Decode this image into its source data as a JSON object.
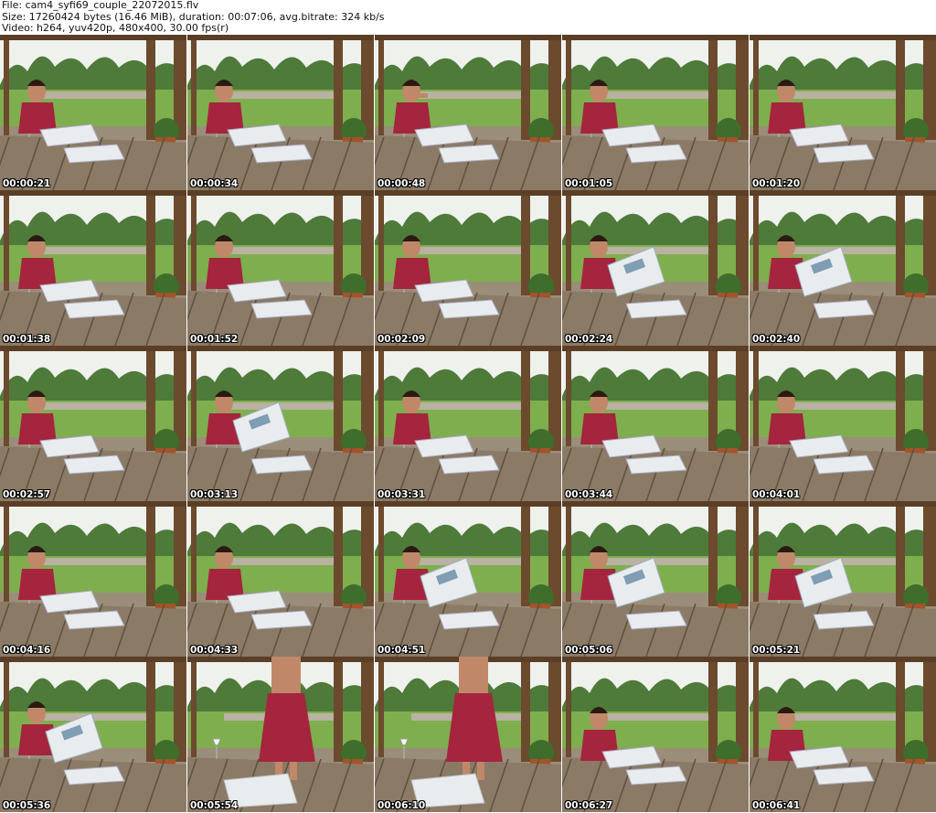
{
  "header": {
    "file_line": "File: cam4_syfi69_couple_22072015.flv",
    "size_line": "Size: 17260424 bytes (16.46 MiB), duration: 00:07:06, avg.bitrate: 324 kb/s",
    "video_line": "Video: h264, yuv420p, 480x400, 30.00 fps(r)"
  },
  "colors": {
    "sky": "#eef1ec",
    "trees": "#4e7a3a",
    "grass": "#7fae4e",
    "table": "#8a7a66",
    "table_dark": "#5e5040",
    "post": "#6b4a2e",
    "dress": "#a5243e",
    "skin": "#c08868",
    "hair": "#2a1a12",
    "paper": "#e8ecee"
  },
  "thumbnails": [
    {
      "time": "00:00:21",
      "scene": "read"
    },
    {
      "time": "00:00:34",
      "scene": "read"
    },
    {
      "time": "00:00:48",
      "scene": "drink"
    },
    {
      "time": "00:01:05",
      "scene": "read"
    },
    {
      "time": "00:01:20",
      "scene": "read"
    },
    {
      "time": "00:01:38",
      "scene": "read"
    },
    {
      "time": "00:01:52",
      "scene": "read"
    },
    {
      "time": "00:02:09",
      "scene": "read"
    },
    {
      "time": "00:02:24",
      "scene": "bigpaper"
    },
    {
      "time": "00:02:40",
      "scene": "bigpaper"
    },
    {
      "time": "00:02:57",
      "scene": "read"
    },
    {
      "time": "00:03:13",
      "scene": "bigpaper"
    },
    {
      "time": "00:03:31",
      "scene": "read"
    },
    {
      "time": "00:03:44",
      "scene": "read"
    },
    {
      "time": "00:04:01",
      "scene": "read"
    },
    {
      "time": "00:04:16",
      "scene": "read"
    },
    {
      "time": "00:04:33",
      "scene": "read"
    },
    {
      "time": "00:04:51",
      "scene": "bigpaper"
    },
    {
      "time": "00:05:06",
      "scene": "bigpaper"
    },
    {
      "time": "00:05:21",
      "scene": "bigpaper"
    },
    {
      "time": "00:05:36",
      "scene": "bigpaper"
    },
    {
      "time": "00:05:54",
      "scene": "standing"
    },
    {
      "time": "00:06:10",
      "scene": "standing"
    },
    {
      "time": "00:06:27",
      "scene": "seated"
    },
    {
      "time": "00:06:41",
      "scene": "seated"
    }
  ]
}
